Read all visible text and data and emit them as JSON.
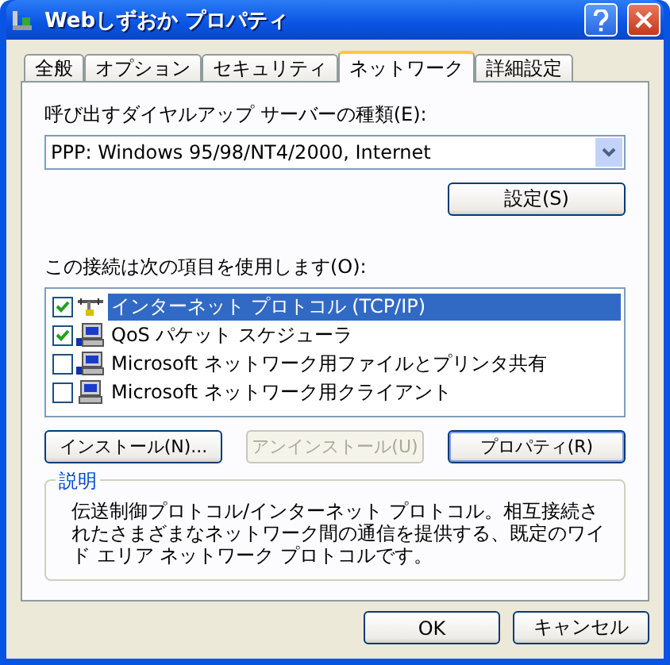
{
  "window": {
    "title": "Webしずおか プロパティ"
  },
  "tabs": [
    {
      "label": "全般",
      "selected": false
    },
    {
      "label": "オプション",
      "selected": false
    },
    {
      "label": "セキュリティ",
      "selected": false
    },
    {
      "label": "ネットワーク",
      "selected": true
    },
    {
      "label": "詳細設定",
      "selected": false
    }
  ],
  "server_type": {
    "label": "呼び出すダイヤルアップ サーバーの種類(E):",
    "value": "PPP: Windows 95/98/NT4/2000, Internet"
  },
  "settings_button": {
    "label": "設定(S)",
    "disabled": false
  },
  "items_label": "この接続は次の項目を使用します(O):",
  "items": [
    {
      "kind": "protocol",
      "label": "インターネット プロトコル (TCP/IP)",
      "checked": true,
      "selected": true
    },
    {
      "kind": "service",
      "label": "QoS パケット スケジューラ",
      "checked": true,
      "selected": false
    },
    {
      "kind": "service",
      "label": "Microsoft ネットワーク用ファイルとプリンタ共有",
      "checked": false,
      "selected": false
    },
    {
      "kind": "client",
      "label": "Microsoft ネットワーク用クライアント",
      "checked": false,
      "selected": false
    }
  ],
  "item_buttons": [
    {
      "label": "インストール(N)...",
      "disabled": false
    },
    {
      "label": "アンインストール(U)",
      "disabled": true
    },
    {
      "label": "プロパティ(R)",
      "disabled": false
    }
  ],
  "description": {
    "title": "説明",
    "text": "伝送制御プロトコル/インターネット プロトコル。相互接続されたさまざまなネットワーク間の通信を提供する、既定のワイド エリア ネットワーク プロトコルです。"
  },
  "buttons": [
    {
      "label": "OK",
      "disabled": false
    },
    {
      "label": "キャンセル",
      "disabled": false
    }
  ]
}
